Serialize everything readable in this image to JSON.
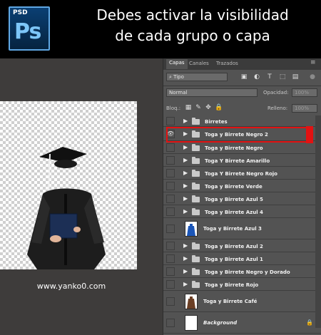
{
  "header": {
    "logo_small": "PSD",
    "logo_big": "Ps",
    "title_line1": "Debes activar la visibilidad",
    "title_line2": "de cada grupo o capa"
  },
  "canvas": {
    "watermark": "www.yanko0.com"
  },
  "panel": {
    "tabs": [
      "Capas",
      "Canales",
      "Trazados"
    ],
    "filter_label": "Tipo",
    "blend_mode": "Normal",
    "opacity_label": "Opacidad:",
    "opacity_value": "100%",
    "lock_label": "Bloq.:",
    "fill_label": "Relleno:",
    "fill_value": "100%",
    "layers": [
      {
        "name": "Birretes",
        "kind": "group",
        "visible": false
      },
      {
        "name": "Toga y Birrete Negro 2",
        "kind": "group",
        "visible": true,
        "highlighted": true
      },
      {
        "name": "Toga y Birrete Negro",
        "kind": "group",
        "visible": false
      },
      {
        "name": "Toga Y Birrete Amarillo",
        "kind": "group",
        "visible": false
      },
      {
        "name": "Toga Y Birrete Negro Rojo",
        "kind": "group",
        "visible": false
      },
      {
        "name": "Toga y Birrete Verde",
        "kind": "group",
        "visible": false
      },
      {
        "name": "Toga y Birrete Azul 5",
        "kind": "group",
        "visible": false
      },
      {
        "name": "Toga y Birrete Azul 4",
        "kind": "group",
        "visible": false
      },
      {
        "name": "Toga y Birrete Azul 3",
        "kind": "layer",
        "visible": false
      },
      {
        "name": "Toga y Birrete Azul 2",
        "kind": "group",
        "visible": false
      },
      {
        "name": "Toga y Birrete Azul 1",
        "kind": "group",
        "visible": false
      },
      {
        "name": "Toga y Birrete Negro y Dorado",
        "kind": "group",
        "visible": false
      },
      {
        "name": "Toga y Birrete Rojo",
        "kind": "group",
        "visible": false
      },
      {
        "name": "Toga y Birrete Café",
        "kind": "layer",
        "visible": false
      },
      {
        "name": "Background",
        "kind": "background",
        "visible": false
      }
    ]
  },
  "colors": {
    "highlight": "#e21212",
    "panel_bg": "#535353",
    "header_bg": "#000000"
  }
}
